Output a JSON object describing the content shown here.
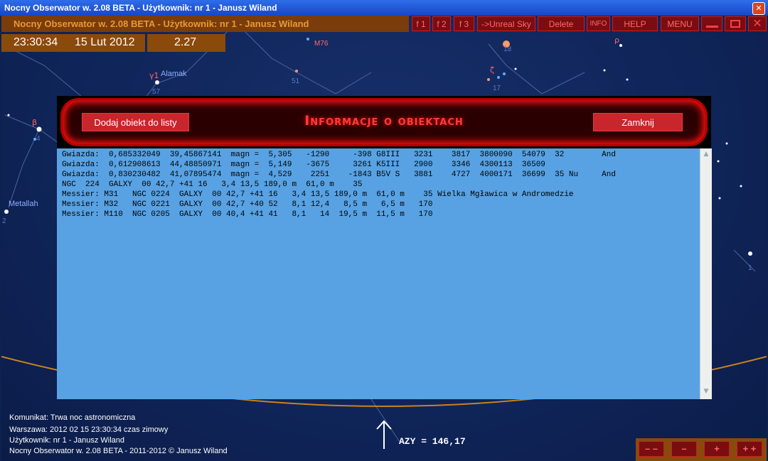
{
  "window": {
    "title": "Nocny Obserwator w. 2.08 BETA -  Użytkownik:  nr 1 - Janusz Wiland",
    "close_glyph": "✕"
  },
  "app": {
    "title": "Nocny Obserwator w. 2.08 BETA -  Użytkownik:  nr 1 - Janusz Wiland",
    "time": "23:30:34",
    "date": "15 Lut 2012",
    "value": "2.27"
  },
  "toolbar": {
    "f1": "f 1",
    "f2": "f 2",
    "f3": "f 3",
    "unreal": "->Unreal Sky",
    "delete": "Delete",
    "info": "INFO",
    "help": "HELP",
    "menu": "MENU",
    "minimize_icon": "minimize-icon",
    "maximize_icon": "window-icon",
    "close_icon": "close-icon"
  },
  "sky_labels": {
    "alamak": "Alamak",
    "gamma1": "γ1",
    "n57": "57",
    "n51": "51",
    "m76": "M76",
    "n18": "18",
    "n17": "17",
    "zeta": "ζ",
    "rho": "ρ",
    "beta": "β",
    "metallah": "Metallah",
    "n2": "2",
    "n1": "1",
    "n4": "4"
  },
  "panel": {
    "title": "Informacje o obiektach",
    "add_button": "Dodaj obiekt do listy",
    "close_button": "Zamknij",
    "lines": [
      "Gwiazda:  0,685332049  39,45867141  magn =  5,305   -1290     -398 G8III   3231    3817  3800090  54079  32        And",
      "Gwiazda:  0,612908613  44,48850971  magn =  5,149   -3675     3261 K5III   2900    3346  4300113  36509",
      "Gwiazda:  0,830230482  41,07895474  magn =  4,529    2251    -1843 B5V S   3881    4727  4000171  36699  35 Nu     And",
      "NGC  224  GALXY  00 42,7 +41 16   3,4 13,5 189,0 m  61,0 m    35",
      "Messier: M31   NGC 0224  GALXY  00 42,7 +41 16   3,4 13,5 189,0 m  61,0 m    35 Wielka Mgławica w Andromedzie",
      "Messier: M32   NGC 0221  GALXY  00 42,7 +40 52   8,1 12,4   8,5 m   6,5 m   170",
      "Messier: M110  NGC 0205  GALXY  00 40,4 +41 41   8,1   14  19,5 m  11,5 m   170"
    ]
  },
  "status": {
    "komunikat": "Komunikat: Trwa noc astronomiczna",
    "warszawa": "Warszawa:  2012 02 15  23:30:34 czas zimowy",
    "uzytkownik": "Użytkownik:  nr 1 - Janusz Wiland",
    "footer": "Nocny Obserwator w. 2.08 BETA - 2011-2012 © Janusz Wiland"
  },
  "azimuth": "AZY = 146,17",
  "nav": {
    "far_left": "– –",
    "left": "–",
    "right": "+",
    "far_right": "+ +"
  },
  "colors": {
    "sky": "#0f2458",
    "horizon": "#c8821c",
    "panel_red": "#c7262c",
    "text_area": "#58a2e4"
  }
}
